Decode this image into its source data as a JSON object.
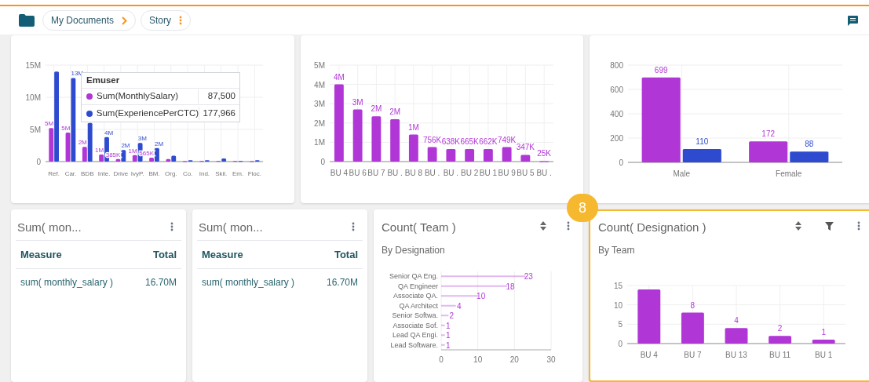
{
  "toolbar": {
    "breadcrumb": [
      {
        "label": "My Documents"
      },
      {
        "label": "Story"
      }
    ]
  },
  "top_charts": [
    {
      "chart_data": {
        "type": "bar",
        "grid": true,
        "categories": [
          "Ref.",
          "Car.",
          "BDB",
          "Inte.",
          "Drive",
          "IvyP.",
          "BM.",
          "Org.",
          "Co.",
          "Ind.",
          "Skil.",
          "Em.",
          "Floc."
        ],
        "series": [
          {
            "name": "Sum(MonthlySalary)",
            "color": "#b036d6",
            "values": [
              5200000,
              4500000,
              2300000,
              1100000,
              400000,
              1000000,
              600000,
              400000,
              50000,
              100000,
              100000,
              100000,
              50000
            ]
          },
          {
            "name": "Sum(ExperiencePerCTC)",
            "color": "#2e4bd0",
            "values": [
              14000000,
              13000000,
              6000000,
              3800000,
              1800000,
              2900000,
              2100000,
              900000,
              200000,
              200000,
              500000,
              100000,
              200000
            ]
          }
        ],
        "ylim": [
          0,
          15000000
        ],
        "yticks": [
          {
            "value": 0,
            "label": "0"
          },
          {
            "value": 5000000,
            "label": "5M"
          },
          {
            "value": 10000000,
            "label": "10M"
          },
          {
            "value": 15000000,
            "label": "15M"
          }
        ],
        "value_labels": [
          [
            "5M",
            "5M",
            "2M",
            "1M",
            "385K",
            "1M",
            "565K",
            null,
            null,
            null,
            null,
            null,
            null
          ],
          [
            null,
            "13M",
            null,
            "4M",
            "2M",
            "3M",
            "2M",
            null,
            null,
            null,
            null,
            null,
            null
          ]
        ]
      },
      "tooltip": {
        "title": "Emuser",
        "rows": [
          {
            "value": "87,500"
          },
          {
            "value": "177,966"
          }
        ]
      }
    },
    {
      "chart_data": {
        "type": "bar",
        "grid": true,
        "categories": [
          "BU 4",
          "BU 6",
          "BU 7",
          "BU .",
          "BU 8",
          "BU .",
          "BU .",
          "BU 2",
          "BU 1",
          "BU 9",
          "BU 5",
          "BU ."
        ],
        "series": [
          {
            "color": "#b036d6",
            "values": [
              4000000,
              2700000,
              2350000,
              2200000,
              1400000,
              750000,
              650000,
              650000,
              650000,
              750000,
              350000,
              25000
            ]
          }
        ],
        "ylim": [
          0,
          5000000
        ],
        "yticks": [
          {
            "value": 0,
            "label": "0"
          },
          {
            "value": 1000000,
            "label": "1M"
          },
          {
            "value": 2000000,
            "label": "2M"
          },
          {
            "value": 3000000,
            "label": "3M"
          },
          {
            "value": 4000000,
            "label": "4M"
          },
          {
            "value": 5000000,
            "label": "5M"
          }
        ],
        "value_labels": [
          [
            "4M",
            "3M",
            "2M",
            "2M",
            "1M",
            "756K",
            "638K",
            "665K",
            "662K",
            "749K",
            "347K",
            "25K"
          ]
        ]
      }
    },
    {
      "chart_data": {
        "type": "bar",
        "grid": true,
        "categories": [
          "Male",
          "Female"
        ],
        "series": [
          {
            "color": "#b036d6",
            "values": [
              699,
              172
            ]
          },
          {
            "color": "#2e4bd0",
            "values": [
              110,
              88
            ]
          }
        ],
        "ylim": [
          0,
          800
        ],
        "yticks": [
          0,
          200,
          400,
          600,
          800
        ],
        "value_labels": [
          [
            "699",
            "172"
          ],
          [
            "110",
            "88"
          ]
        ]
      }
    }
  ],
  "table_cards": [
    {
      "title": "Sum( mon...",
      "columns": [
        "Measure",
        "Total"
      ],
      "rows": [
        [
          "sum( monthly_salary )",
          "16.70M"
        ]
      ]
    },
    {
      "title": "Sum( mon...",
      "columns": [
        "Measure",
        "Total"
      ],
      "rows": [
        [
          "sum( monthly_salary )",
          "16.70M"
        ]
      ]
    }
  ],
  "team_card": {
    "title": "Count( Team )",
    "subtitle": "By Designation",
    "selected": false,
    "chart_data": {
      "type": "bar",
      "grid": true,
      "orientation": "horizontal",
      "categories": [
        "Senior QA Eng.",
        "QA Engineer",
        "Associate QA.",
        "QA Architect",
        "Senior Softwa.",
        "Associate Sof.",
        "Lead QA Engi.",
        "Lead Software."
      ],
      "series": [
        {
          "color": "#b036d6",
          "values": [
            23,
            18,
            10,
            4,
            2,
            1,
            1,
            1
          ]
        }
      ],
      "xlim": [
        0,
        30
      ],
      "xticks": [
        0,
        10,
        20,
        30
      ],
      "data_labels": true
    }
  },
  "designation_card": {
    "title": "Count( Designation )",
    "subtitle": "By Team",
    "selected": true,
    "badge": "8",
    "chart_data": {
      "type": "bar",
      "grid": true,
      "categories": [
        "BU 4",
        "BU 7",
        "BU 13",
        "BU 11",
        "BU 1"
      ],
      "series": [
        {
          "color": "#b036d6",
          "values": [
            14,
            8,
            4,
            2,
            1
          ]
        }
      ],
      "ylim": [
        0,
        15
      ],
      "yticks": [
        0,
        5,
        10,
        15
      ],
      "value_labels": [
        [
          null,
          "8",
          "4",
          "2",
          "1"
        ]
      ]
    }
  }
}
